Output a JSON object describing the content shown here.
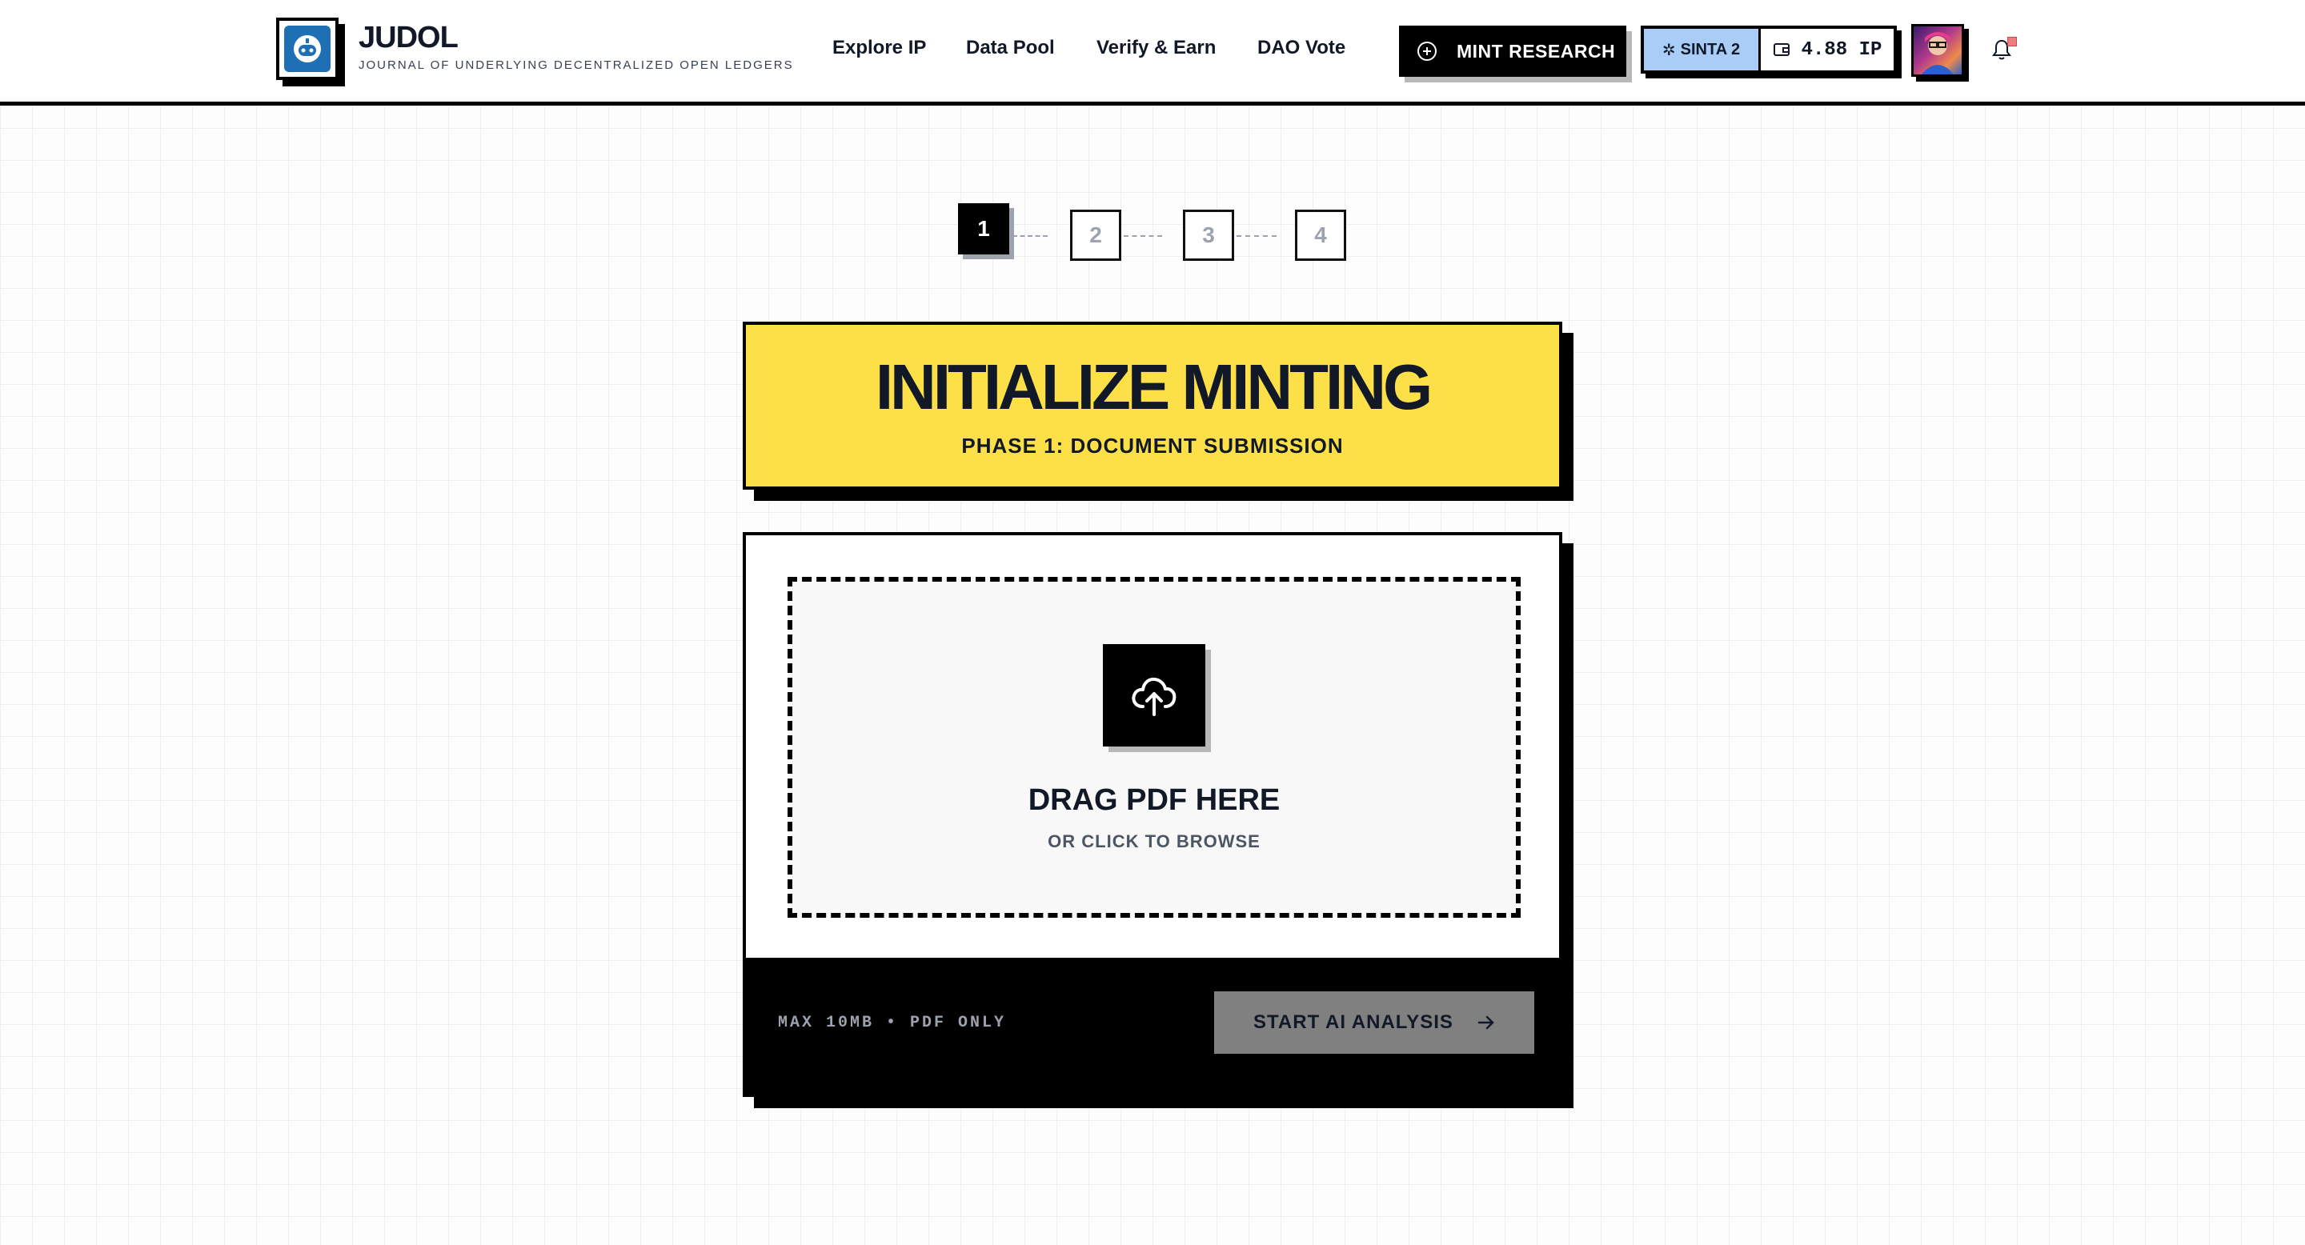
{
  "header": {
    "brand": {
      "logo_icon": "research-robot-icon",
      "title": "JUDOL",
      "subtitle": "JOURNAL OF UNDERLYING DECENTRALIZED OPEN LEDGERS"
    },
    "nav": [
      {
        "label": "Explore IP"
      },
      {
        "label": "Data Pool"
      },
      {
        "label": "Verify & Earn"
      },
      {
        "label": "DAO Vote"
      }
    ],
    "mint_button": {
      "icon": "plus-circle-icon",
      "label": "MINT RESEARCH"
    },
    "wallet": {
      "sinta_icon": "sparkle-icon",
      "sinta_label": "SINTA 2",
      "wallet_icon": "wallet-icon",
      "balance": "4.88 IP"
    },
    "avatar": {
      "icon": "user-avatar"
    },
    "notifications": {
      "icon": "bell-icon",
      "has_unread": true
    }
  },
  "stepper": {
    "current_step": 1,
    "steps": [
      "1",
      "2",
      "3",
      "4"
    ]
  },
  "title_card": {
    "title": "INITIALIZE MINTING",
    "subtitle": "PHASE 1: DOCUMENT SUBMISSION"
  },
  "upload": {
    "icon": "cloud-upload-icon",
    "title": "DRAG PDF HERE",
    "subtitle": "OR CLICK TO BROWSE",
    "limits": "MAX 10MB • PDF ONLY",
    "action_label": "START AI ANALYSIS",
    "action_icon": "arrow-right-icon"
  },
  "colors": {
    "accent_yellow": "#fde047",
    "badge_blue": "#a9cdf6",
    "logo_blue": "#1f6fb5",
    "disabled_button": "#808080",
    "notification_dot": "#ef7d7d"
  }
}
